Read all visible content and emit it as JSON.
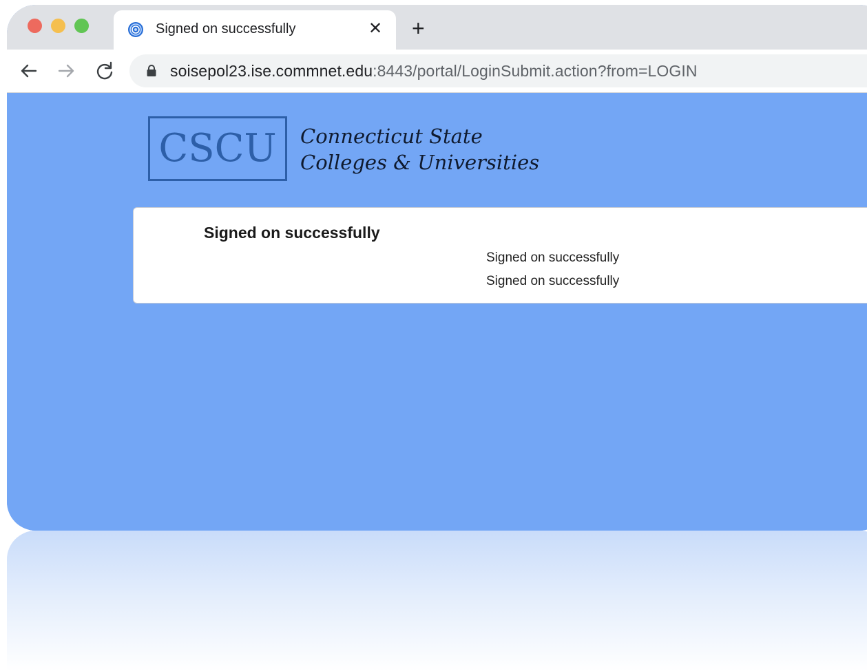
{
  "browser": {
    "tab": {
      "title": "Signed on successfully",
      "close_glyph": "✕",
      "favicon": "globe-favicon-icon"
    },
    "new_tab_glyph": "+",
    "url": {
      "host": "soisepol23.ise.commnet.edu",
      "rest": ":8443/portal/LoginSubmit.action?from=LOGIN"
    },
    "icons": [
      "back-arrow-icon",
      "forward-arrow-icon",
      "reload-icon",
      "lock-icon"
    ]
  },
  "brand": {
    "logo_abbr": "CSCU",
    "name_line1": "Connecticut State",
    "name_line2": "Colleges & Universities"
  },
  "main": {
    "title": "Signed on successfully",
    "messages": [
      "Signed on successfully",
      "Signed on successfully"
    ]
  },
  "colors": {
    "page_background": "#73a6f5",
    "logo_blue": "#2d5fa8",
    "card_background": "#ffffff"
  }
}
